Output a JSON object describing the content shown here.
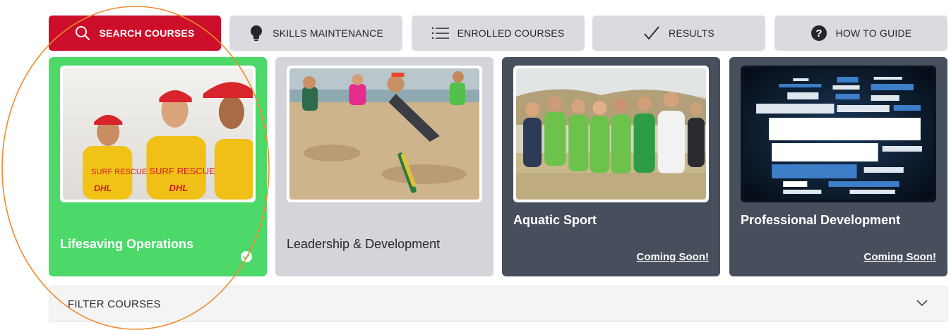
{
  "tabs": [
    {
      "label": "SEARCH COURSES",
      "icon": "search-icon",
      "active": true
    },
    {
      "label": "SKILLS MAINTENANCE",
      "icon": "lightbulb-icon",
      "active": false
    },
    {
      "label": "ENROLLED COURSES",
      "icon": "list-icon",
      "active": false
    },
    {
      "label": "RESULTS",
      "icon": "checkmark-icon",
      "active": false
    },
    {
      "label": "HOW TO GUIDE",
      "icon": "question-circle-icon",
      "active": false
    }
  ],
  "cards": [
    {
      "title": "Lifesaving Operations",
      "badge_icon": "check-circle-icon",
      "photo": "lifesavers-photo",
      "shirt_text_1": "SURF RESCUE",
      "shirt_text_2": "SURF RESCUE",
      "sponsor": "DHL"
    },
    {
      "title": "Leadership & Development",
      "photo": "beach-flags-photo"
    },
    {
      "title": "Aquatic Sport",
      "status": "Coming Soon!",
      "photo": "team-group-photo"
    },
    {
      "title": "Professional Development",
      "status": "Coming Soon!",
      "photo": "vocational-education-word-cloud"
    }
  ],
  "filter": {
    "label": "FILTER COURSES",
    "icon": "chevron-down-icon"
  },
  "colors": {
    "active_tab": "#cc0e2b",
    "tab": "#d9dbe0",
    "card_selected": "#4cd96a",
    "card_default": "#d3d5da",
    "card_dark": "#474f5c",
    "annotation": "#f08a2c"
  }
}
